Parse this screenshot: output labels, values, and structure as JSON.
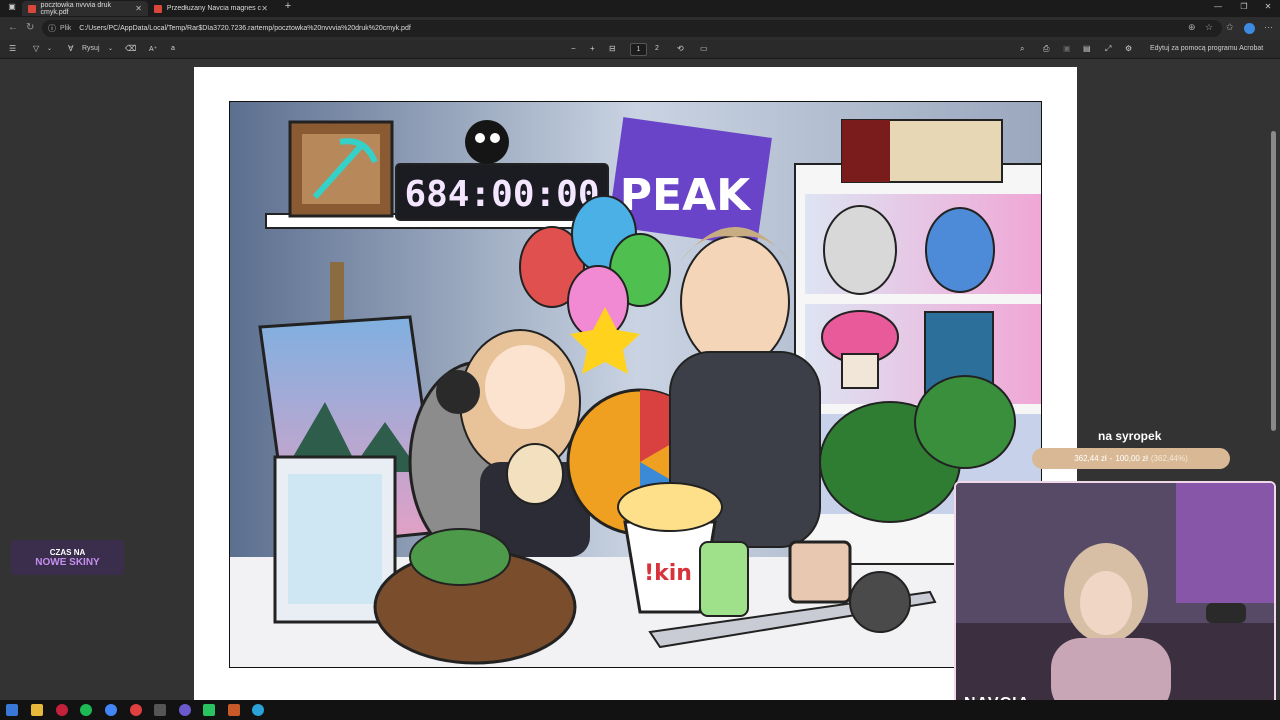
{
  "browser": {
    "tabs": [
      {
        "title": "pocztowka nvvvia druk cmyk.pdf",
        "active": true
      },
      {
        "title": "Przedłużany Navcia magnes cmyk...",
        "active": false
      }
    ],
    "address": {
      "prefix": "Plik",
      "url": "C:/Users/PC/AppData/Local/Temp/Rar$DIa3720.7236.rartemp/pocztowka%20nvvvia%20druk%20cmyk.pdf"
    }
  },
  "pdf_toolbar": {
    "draw_label": "Rysuj",
    "page_current": "1",
    "page_total": "2",
    "edit_label": "Edytuj za pomocą programu Acrobat"
  },
  "artwork": {
    "timer": "684:00:00",
    "sign": "PEAK",
    "cup_text": "!kin"
  },
  "overlay": {
    "goal_title": "na syropek",
    "goal_amount": "362,44 zł",
    "goal_separator": "-",
    "goal_target": "100,00 zł",
    "goal_percent": "(362,44%)",
    "badge_line1": "CZAS NA",
    "badge_line2": "NOWE SKINY",
    "cam_label": "NAVCIA"
  },
  "colors": {
    "accent": "#d9b995",
    "page": "#ffffff",
    "viewer_bg": "#333333"
  }
}
